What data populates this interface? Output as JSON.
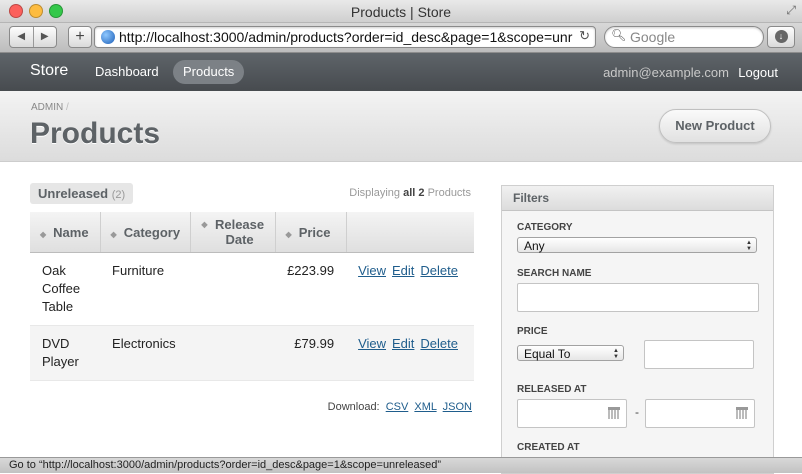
{
  "window": {
    "title": "Products | Store"
  },
  "browser": {
    "url": "http://localhost:3000/admin/products?order=id_desc&page=1&scope=unre",
    "search_placeholder": "Google",
    "add_label": "+",
    "reload_glyph": "↻",
    "download_glyph": "↓",
    "back_glyph": "◀",
    "forward_glyph": "▶"
  },
  "nav": {
    "brand": "Store",
    "items": [
      {
        "label": "Dashboard",
        "active": false
      },
      {
        "label": "Products",
        "active": true
      }
    ],
    "user_email": "admin@example.com",
    "logout": "Logout"
  },
  "page": {
    "breadcrumb": [
      "ADMIN"
    ],
    "breadcrumb_sep": "/",
    "title": "Products",
    "action_button": "New Product"
  },
  "index": {
    "scope_label": "Unreleased",
    "scope_count": "(2)",
    "displaying_prefix": "Displaying",
    "displaying_bold": "all 2",
    "displaying_suffix": "Products",
    "columns": [
      "Name",
      "Category",
      "Release Date",
      "Price"
    ],
    "rows": [
      {
        "name": "Oak Coffee Table",
        "category": "Furniture",
        "release_date": "",
        "price": "£223.99"
      },
      {
        "name": "DVD Player",
        "category": "Electronics",
        "release_date": "",
        "price": "£79.99"
      }
    ],
    "row_actions": [
      "View",
      "Edit",
      "Delete"
    ],
    "download_label": "Download:",
    "download_formats": [
      "CSV",
      "XML",
      "JSON"
    ]
  },
  "filters": {
    "title": "Filters",
    "category_label": "CATEGORY",
    "category_value": "Any",
    "search_name_label": "SEARCH NAME",
    "search_name_value": "",
    "price_label": "PRICE",
    "price_operator": "Equal To",
    "price_value": "",
    "released_label": "RELEASED AT",
    "range_separator": "-",
    "created_label": "CREATED AT"
  },
  "status_bar": "Go to “http://localhost:3000/admin/products?order=id_desc&page=1&scope=unreleased”",
  "colors": {
    "nav_bg": "#4f5458",
    "title_text": "#5d6266",
    "link": "#1f5d8c",
    "traffic_close": "#fc605c",
    "traffic_min": "#fdbc40",
    "traffic_max": "#34c84a"
  }
}
